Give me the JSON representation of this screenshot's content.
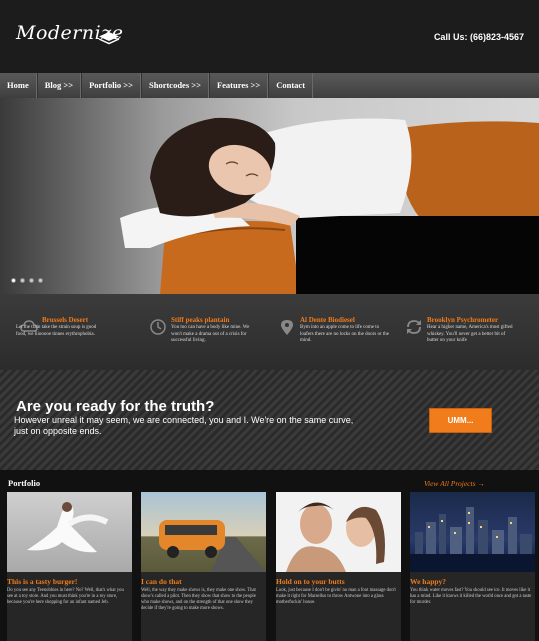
{
  "header": {
    "logo_text": "Modernize",
    "phone": "Call Us: (66)823-4567"
  },
  "nav": {
    "items": [
      {
        "label": "Home"
      },
      {
        "label": "Blog >>"
      },
      {
        "label": "Portfolio >>"
      },
      {
        "label": "Shortcodes >>"
      },
      {
        "label": "Features >>"
      },
      {
        "label": "Contact"
      }
    ]
  },
  "slider": {
    "slide_count": 4,
    "active_slide": 1
  },
  "features": [
    {
      "icon": "cloud-icon",
      "title": "Brussels Desert",
      "text": "Let the train take the strain soup is good food, we liiooooe tinnes erythrophobia."
    },
    {
      "icon": "clock-icon",
      "title": "Stiff peaks plantain",
      "text": "You too can have a body like mine. We won't make a drama out of a crisis for successful living."
    },
    {
      "icon": "map-pin-icon",
      "title": "Al Dente Biodiesel",
      "text": "Bym into an apple come to life come to loafers there are no locks on the doors or the mind."
    },
    {
      "icon": "refresh-icon",
      "title": "Brooklyn Psychrometer",
      "text": "Hear a higher name, America's most gifted whiskey. You'll never get a better bit of butter on your knife"
    }
  ],
  "cta": {
    "title": "Are you ready for the truth?",
    "text": "However unreal it may seem, we are connected, you and I. We're on the same curve, just on opposite ends.",
    "button_label": "UMM..."
  },
  "portfolio": {
    "heading": "Portfolio",
    "view_all": "View All Projects →",
    "items": [
      {
        "title": "This is a tasty burger!",
        "text": "Do you see any Teenobbies in here? No? Well, that's what you see at a toy store. And you must think you're in a toy store, because you're here shopping for an infant named Jeb."
      },
      {
        "title": "I can do that",
        "text": "Well, the way they make shows is, they make one show. That show's called a pilot. Then they show that show to the people who make shows, and on the strength of that one show they decide if they're going to make more shows."
      },
      {
        "title": "Hold on to your butts",
        "text": "Look, just because I don't be givin' no man a foot massage don't make it right for Marsellus to throw Antwone into a glass motherfuckin' house."
      },
      {
        "title": "We happy?",
        "text": "You think water moves fast? You should see ice. It moves like it has a mind. Like it knows it killed the world once and got a taste for murder."
      }
    ]
  },
  "colors": {
    "accent": "#f07c1c",
    "header_bg": "#1c1c1c",
    "nav_bg": "#4a4a4a"
  }
}
